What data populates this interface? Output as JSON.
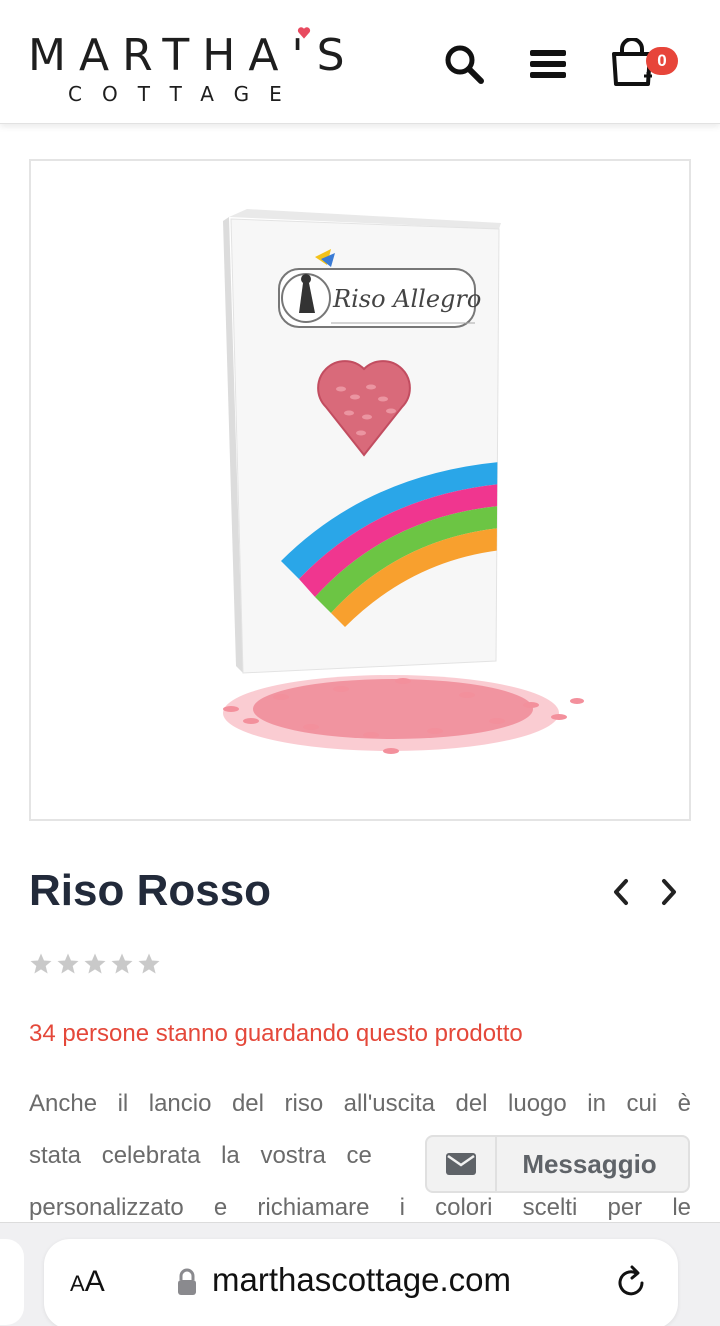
{
  "header": {
    "logo_main": "MARTHA'S",
    "logo_sub": "COTTAGE",
    "cart_count": "0",
    "icons": [
      "search-icon",
      "menu-icon",
      "cart-icon"
    ]
  },
  "product": {
    "image_alt": "Riso Allegro",
    "package_brand": "Riso Allegro",
    "title": "Riso Rosso",
    "rating_stars": 0,
    "rating_max": 5,
    "viewers_text": "34 persone stanno guardando questo prodotto",
    "description_lines": [
      "Anche il lancio del riso all'uscita del luogo in cui è",
      "stata celebrata la vostra ce",
      "personalizzato e richiamare i colori scelti per le"
    ]
  },
  "message_button": {
    "label": "Messaggio"
  },
  "browser": {
    "text_size_label": "AA",
    "url": "marthascottage.com"
  },
  "colors": {
    "accent_red": "#e4483a",
    "title_dark": "#222a3a",
    "badge_red": "#e7453a",
    "rice_pink": "#f08a96"
  }
}
